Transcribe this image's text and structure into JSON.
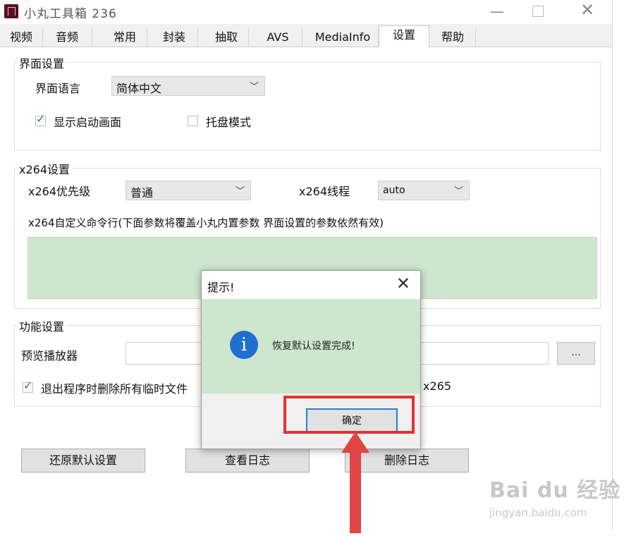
{
  "window": {
    "title": "小丸工具箱 236",
    "min_glyph": "—",
    "close_glyph": "✕"
  },
  "tabs": [
    {
      "label": "视频"
    },
    {
      "label": "音频"
    },
    {
      "label": "常用"
    },
    {
      "label": "封装"
    },
    {
      "label": "抽取"
    },
    {
      "label": "AVS"
    },
    {
      "label": "MediaInfo"
    },
    {
      "label": "设置",
      "active": true
    },
    {
      "label": "帮助"
    }
  ],
  "ui_settings": {
    "group_label": "界面设置",
    "language_label": "界面语言",
    "language_value": "简体中文",
    "splash_label": "显示启动画面",
    "splash_checked": true,
    "tray_label": "托盘模式",
    "tray_checked": false
  },
  "x264_settings": {
    "group_label": "x264设置",
    "priority_label": "x264优先级",
    "priority_value": "普通",
    "threads_label": "x264线程",
    "threads_value": "auto",
    "custom_cmd_label": "x264自定义命令行(下面参数将覆盖小丸内置参数 界面设置的参数依然有效)",
    "custom_cmd_value": ""
  },
  "function_settings": {
    "group_label": "功能设置",
    "preview_player_label": "预览播放器",
    "preview_player_value": "",
    "browse_label": "...",
    "delete_temp_label": "退出程序时删除所有临时文件",
    "delete_temp_checked": true,
    "x265_label_partial": "x265"
  },
  "buttons": {
    "restore": "还原默认设置",
    "view_log": "查看日志",
    "delete_log": "删除日志"
  },
  "dialog": {
    "title": "提示!",
    "close_glyph": "✕",
    "icon_glyph": "i",
    "message": "恢复默认设置完成!",
    "ok_label": "确定"
  },
  "watermark": {
    "logo": "Bai du 经验",
    "url": "jingyan.baidu.com"
  },
  "colors": {
    "highlight_box": "#e53030",
    "annotation_arrow": "#e24545",
    "info_icon": "#1f6fd0",
    "green_area": "#cde6cd"
  }
}
